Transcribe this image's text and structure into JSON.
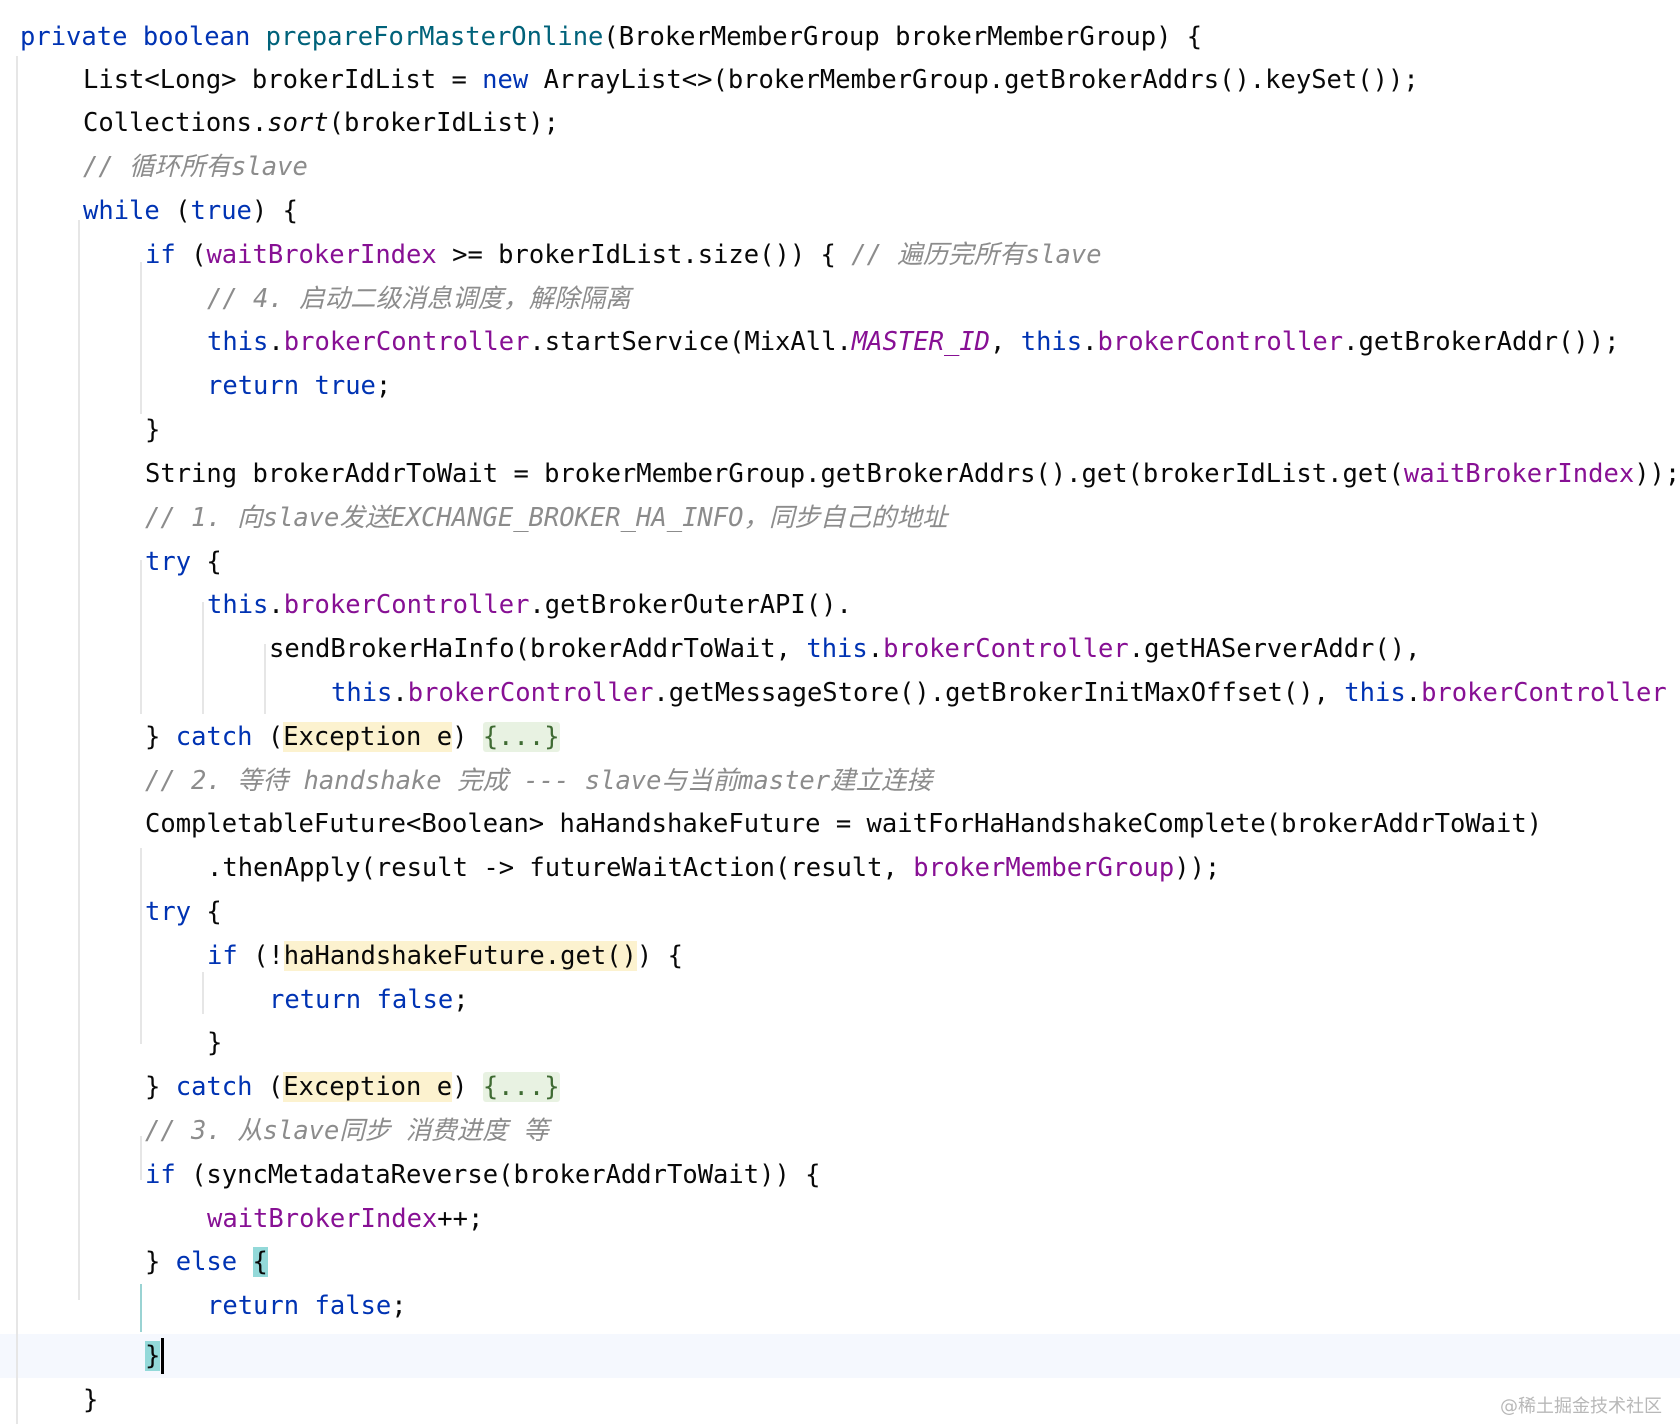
{
  "code": {
    "l1": {
      "kw1": "private",
      "kw2": "boolean",
      "method": "prepareForMasterOnline",
      "rest": "(BrokerMemberGroup brokerMemberGroup) {"
    },
    "l2": {
      "p1": "List<Long> brokerIdList = ",
      "kw": "new",
      "p2": " ArrayList<>(brokerMemberGroup.getBrokerAddrs().keySet());"
    },
    "l3": {
      "p1": "Collections.",
      "static_call": "sort",
      "p2": "(brokerIdList);"
    },
    "l4": {
      "comment": "// 循环所有slave"
    },
    "l5": {
      "kw": "while",
      "p1": " (",
      "kw2": "true",
      "p2": ") {"
    },
    "l6": {
      "kw": "if",
      "p1": " (",
      "field": "waitBrokerIndex",
      "p2": " >= brokerIdList.size()) { ",
      "comment": "// 遍历完所有slave"
    },
    "l7": {
      "comment": "// 4. 启动二级消息调度，解除隔离"
    },
    "l8": {
      "kw": "this",
      "p1": ".",
      "field": "brokerController",
      "p2": ".startService(MixAll.",
      "const": "MASTER_ID",
      "p3": ", ",
      "kw2": "this",
      "p4": ".",
      "field2": "brokerController",
      "p5": ".getBrokerAddr());"
    },
    "l9": {
      "kw": "return",
      "sp": " ",
      "kw2": "true",
      "p1": ";"
    },
    "l10": {
      "p1": "}"
    },
    "l11": {
      "p1": "String brokerAddrToWait = brokerMemberGroup.getBrokerAddrs().get(brokerIdList.get(",
      "field": "waitBrokerIndex",
      "p2": "));"
    },
    "l12": {
      "comment": "// 1. 向slave发送EXCHANGE_BROKER_HA_INFO，同步自己的地址"
    },
    "l13": {
      "kw": "try",
      "p1": " {"
    },
    "l14": {
      "kw": "this",
      "p1": ".",
      "field": "brokerController",
      "p2": ".getBrokerOuterAPI()."
    },
    "l15": {
      "p1": "sendBrokerHaInfo(brokerAddrToWait, ",
      "kw": "this",
      "p2": ".",
      "field": "brokerController",
      "p3": ".getHAServerAddr(),"
    },
    "l16": {
      "kw": "this",
      "p1": ".",
      "field": "brokerController",
      "p2": ".getMessageStore().getBrokerInitMaxOffset(), ",
      "kw2": "this",
      "p3": ".",
      "field2": "brokerController"
    },
    "l17": {
      "p1": "} ",
      "kw": "catch",
      "p2": " (",
      "hl": "Exception e",
      "p3": ") ",
      "fold": "{...}"
    },
    "l18": {
      "comment": "// 2. 等待 handshake 完成 --- slave与当前master建立连接"
    },
    "l19": {
      "p1": "CompletableFuture<Boolean> haHandshakeFuture = waitForHaHandshakeComplete(brokerAddrToWait)"
    },
    "l20": {
      "p1": ".thenApply(result -> futureWaitAction(result, ",
      "field": "brokerMemberGroup",
      "p2": "));"
    },
    "l21": {
      "kw": "try",
      "p1": " {"
    },
    "l22": {
      "kw": "if",
      "p1": " (!",
      "hl": "haHandshakeFuture.get()",
      "p2": ") {"
    },
    "l23": {
      "kw": "return",
      "sp": " ",
      "kw2": "false",
      "p1": ";"
    },
    "l24": {
      "p1": "}"
    },
    "l25": {
      "p1": "} ",
      "kw": "catch",
      "p2": " (",
      "hl": "Exception e",
      "p3": ") ",
      "fold": "{...}"
    },
    "l26": {
      "comment": "// 3. 从slave同步 消费进度 等"
    },
    "l27": {
      "kw": "if",
      "p1": " (syncMetadataReverse(brokerAddrToWait)) {"
    },
    "l28": {
      "field": "waitBrokerIndex",
      "p1": "++;"
    },
    "l29": {
      "p1": "} ",
      "kw": "else",
      "sp": " ",
      "brace": "{"
    },
    "l30": {
      "kw": "return",
      "sp": " ",
      "kw2": "false",
      "p1": ";"
    },
    "l31": {
      "brace": "}"
    },
    "l32": {
      "p1": "}"
    }
  },
  "watermark": "@稀土掘金技术社区",
  "colors": {
    "keyword": "#0033b3",
    "method_declaration": "#00627a",
    "field": "#871094",
    "comment": "#8c8c8c",
    "folded_region": "#e8f2e2",
    "usage_highlight": "#fcf2cf",
    "matched_brace": "#93d9d9",
    "caret_line": "#f5f8fe"
  }
}
